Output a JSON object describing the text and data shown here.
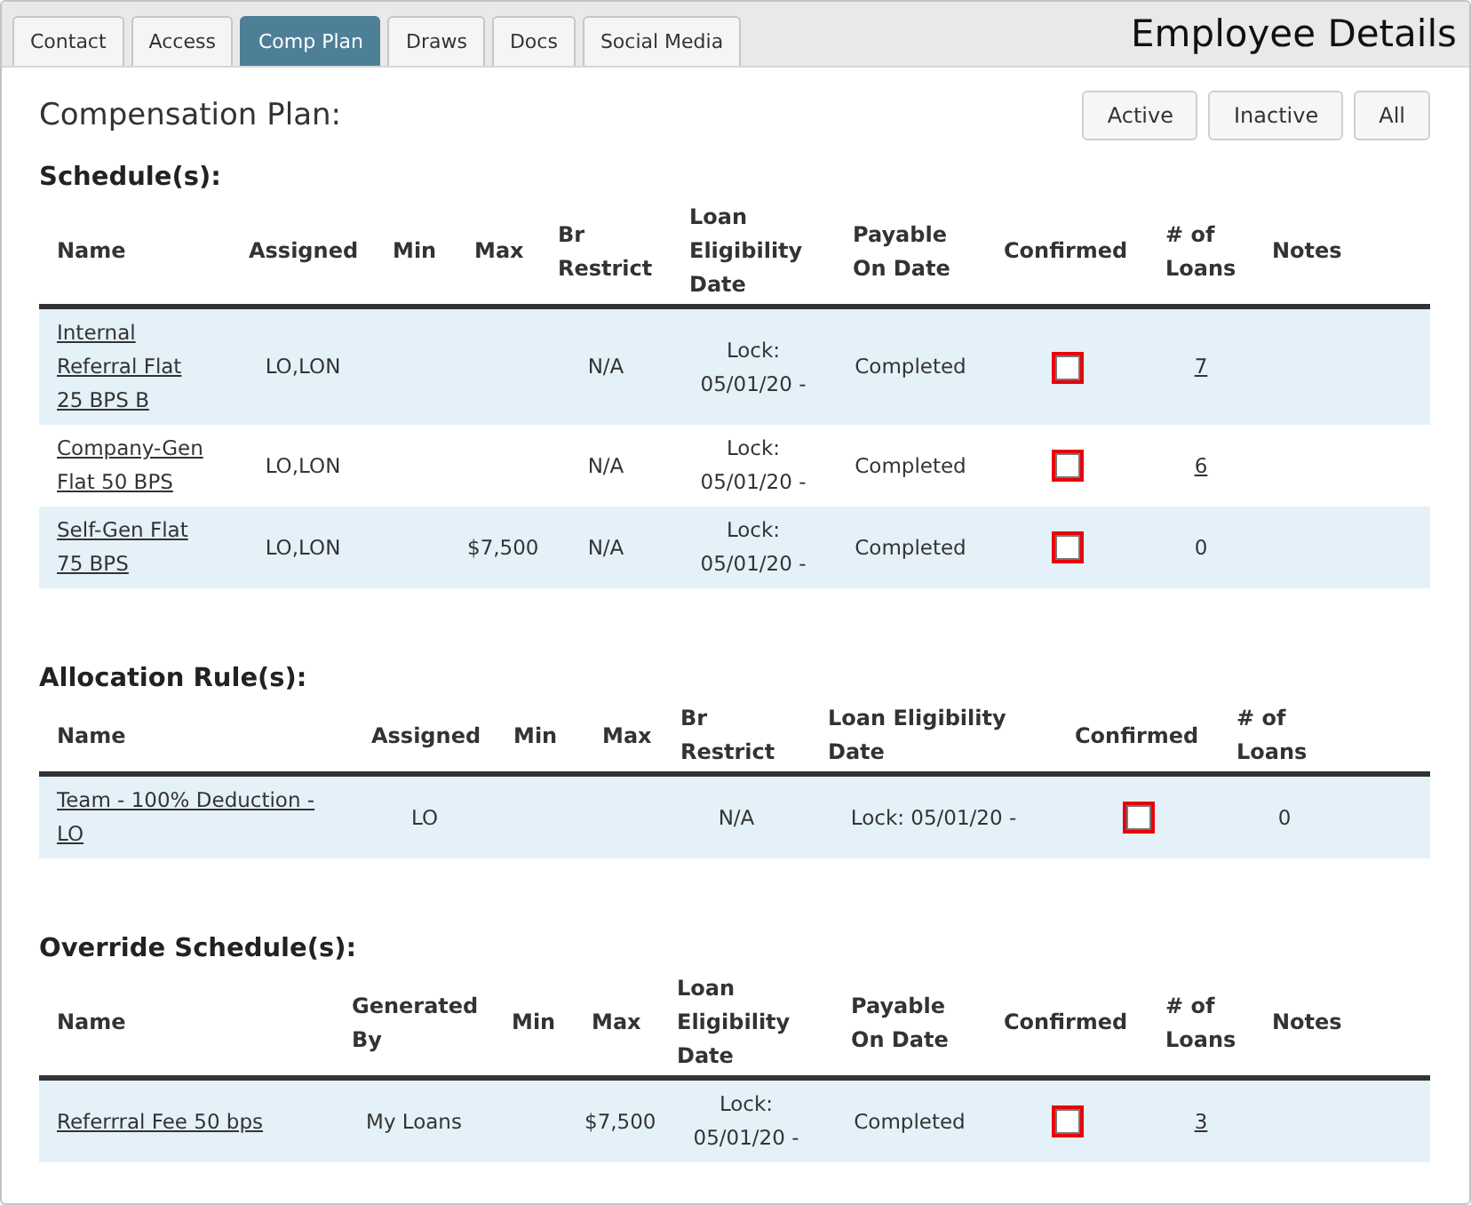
{
  "tabs": [
    {
      "label": "Contact",
      "selected": false
    },
    {
      "label": "Access",
      "selected": false
    },
    {
      "label": "Comp Plan",
      "selected": true
    },
    {
      "label": "Draws",
      "selected": false
    },
    {
      "label": "Docs",
      "selected": false
    },
    {
      "label": "Social Media",
      "selected": false
    }
  ],
  "header": {
    "title": "Employee Details"
  },
  "plan": {
    "title": "Compensation Plan:",
    "filters": [
      "Active",
      "Inactive",
      "All"
    ]
  },
  "sections": [
    {
      "title": "Schedule(s):",
      "columns": [
        {
          "label": "Name",
          "kind": "name"
        },
        {
          "label": "Assigned",
          "kind": "assigned"
        },
        {
          "label": "Min",
          "kind": "min"
        },
        {
          "label": "Max",
          "kind": "max"
        },
        {
          "label": "Br Restrict",
          "kind": "br_restrict"
        },
        {
          "label": "Loan Eligibility Date",
          "kind": "loan_eligibility_date"
        },
        {
          "label": "Payable On Date",
          "kind": "payable_on_date"
        },
        {
          "label": "Confirmed",
          "kind": "confirmed"
        },
        {
          "label": "# of Loans",
          "kind": "loans"
        },
        {
          "label": "Notes",
          "kind": "notes"
        }
      ],
      "rows": [
        {
          "name": "Internal Referral Flat 25 BPS B",
          "assigned": "LO,LON",
          "br_restrict": "N/A",
          "loan_eligibility_date": "Lock: 05/01/20 -",
          "payable_on_date": "Completed",
          "confirmed": false,
          "loans": {
            "text": "7",
            "linked": true
          }
        },
        {
          "name": "Company-Gen Flat 50 BPS",
          "assigned": "LO,LON",
          "br_restrict": "N/A",
          "loan_eligibility_date": "Lock: 05/01/20 -",
          "payable_on_date": "Completed",
          "confirmed": false,
          "loans": {
            "text": "6",
            "linked": true
          }
        },
        {
          "name": "Self-Gen Flat 75 BPS",
          "assigned": "LO,LON",
          "max": "$7,500",
          "br_restrict": "N/A",
          "loan_eligibility_date": "Lock: 05/01/20 -",
          "payable_on_date": "Completed",
          "confirmed": false,
          "loans": {
            "text": "0",
            "linked": false
          }
        }
      ]
    },
    {
      "title": "Allocation Rule(s):",
      "columns": [
        {
          "label": "Name",
          "kind": "name"
        },
        {
          "label": "Assigned",
          "kind": "assigned"
        },
        {
          "label": "Min",
          "kind": "min"
        },
        {
          "label": "Max",
          "kind": "max"
        },
        {
          "label": "Br Restrict",
          "kind": "br_restrict"
        },
        {
          "label": "Loan Eligibility Date",
          "kind": "loan_eligibility_date"
        },
        {
          "label": "Confirmed",
          "kind": "confirmed"
        },
        {
          "label": "# of Loans",
          "kind": "loans"
        }
      ],
      "rows": [
        {
          "name": "Team - 100% Deduction - LO",
          "assigned": "LO",
          "br_restrict": "N/A",
          "loan_eligibility_date": "Lock: 05/01/20 -",
          "confirmed": false,
          "loans": {
            "text": "0",
            "linked": false
          }
        }
      ]
    },
    {
      "title": "Override Schedule(s):",
      "columns": [
        {
          "label": "Name",
          "kind": "name"
        },
        {
          "label": "Generated By",
          "kind": "generated_by"
        },
        {
          "label": "Min",
          "kind": "min"
        },
        {
          "label": "Max",
          "kind": "max"
        },
        {
          "label": "Loan Eligibility Date",
          "kind": "loan_eligibility_date"
        },
        {
          "label": "Payable On Date",
          "kind": "payable_on_date"
        },
        {
          "label": "Confirmed",
          "kind": "confirmed"
        },
        {
          "label": "# of Loans",
          "kind": "loans"
        },
        {
          "label": "Notes",
          "kind": "notes"
        }
      ],
      "rows": [
        {
          "name": "Referrral Fee 50 bps",
          "generated_by": "My Loans",
          "max": "$7,500",
          "loan_eligibility_date": "Lock: 05/01/20 -",
          "payable_on_date": "Completed",
          "confirmed": false,
          "loans": {
            "text": "3",
            "linked": true
          }
        }
      ]
    }
  ]
}
